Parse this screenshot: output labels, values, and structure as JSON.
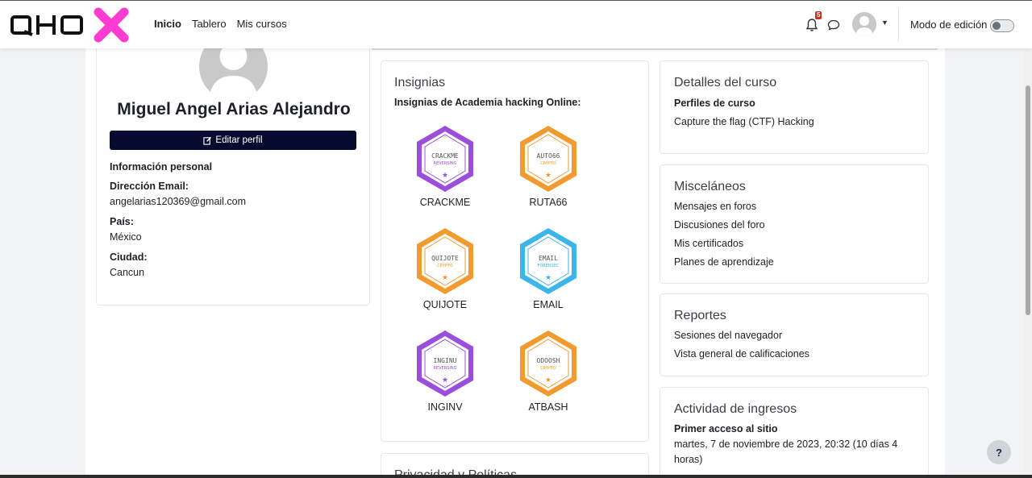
{
  "navbar": {
    "logo_text": "QHOX",
    "links": [
      "Inicio",
      "Tablero",
      "Mis cursos"
    ],
    "notification_count": "5",
    "edit_mode_label": "Modo de edición",
    "edit_mode_on": false
  },
  "profile": {
    "name": "Miguel Angel Arias Alejandro",
    "edit_button": "Editar perfil",
    "section_title": "Información personal",
    "email_label": "Dirección Email:",
    "email": "angelarias120369@gmail.com",
    "country_label": "País:",
    "country": "México",
    "city_label": "Ciudad:",
    "city": "Cancun"
  },
  "badges": {
    "title": "Insignias",
    "subtitle": "Insignias de Academia hacking Online:",
    "items": [
      {
        "name": "CRACKME",
        "top": "CRACKME",
        "bottom": "REVERSING",
        "color": "#9b4ddb",
        "icon": "crackme-badge-icon"
      },
      {
        "name": "RUTA66",
        "top": "AUTO66",
        "bottom": "CRYPTO",
        "color": "#f29a2e",
        "icon": "ruta66-badge-icon"
      },
      {
        "name": "QUIJOTE",
        "top": "QUIJOTE",
        "bottom": "CRYPTO",
        "color": "#f29a2e",
        "icon": "quijote-badge-icon"
      },
      {
        "name": "EMAIL",
        "top": "EMAIL",
        "bottom": "FORENSEC",
        "color": "#3bb6ea",
        "icon": "email-badge-icon"
      },
      {
        "name": "INGINV",
        "top": "INGINU",
        "bottom": "REVERSING",
        "color": "#9b4ddb",
        "icon": "inginv-badge-icon"
      },
      {
        "name": "ATBASH",
        "top": "ODOOSH",
        "bottom": "CRYPTO",
        "color": "#f29a2e",
        "icon": "atbash-badge-icon"
      }
    ]
  },
  "privacy": {
    "title": "Privacidad y Políticas"
  },
  "course_details": {
    "title": "Detalles del curso",
    "profiles_label": "Perfiles de curso",
    "course_link": "Capture the flag (CTF) Hacking"
  },
  "misc": {
    "title": "Misceláneos",
    "links": [
      "Mensajes en foros",
      "Discusiones del foro",
      "Mis certificados",
      "Planes de aprendizaje"
    ]
  },
  "reports": {
    "title": "Reportes",
    "links": [
      "Sesiones del navegador",
      "Vista general de calificaciones"
    ]
  },
  "login_activity": {
    "title": "Actividad de ingresos",
    "first_access_label": "Primer acceso al sitio",
    "first_access_line1": "martes, 7 de noviembre de 2023, 20:32  (10 días 4",
    "first_access_line2": "horas)"
  },
  "help": {
    "label": "?"
  }
}
